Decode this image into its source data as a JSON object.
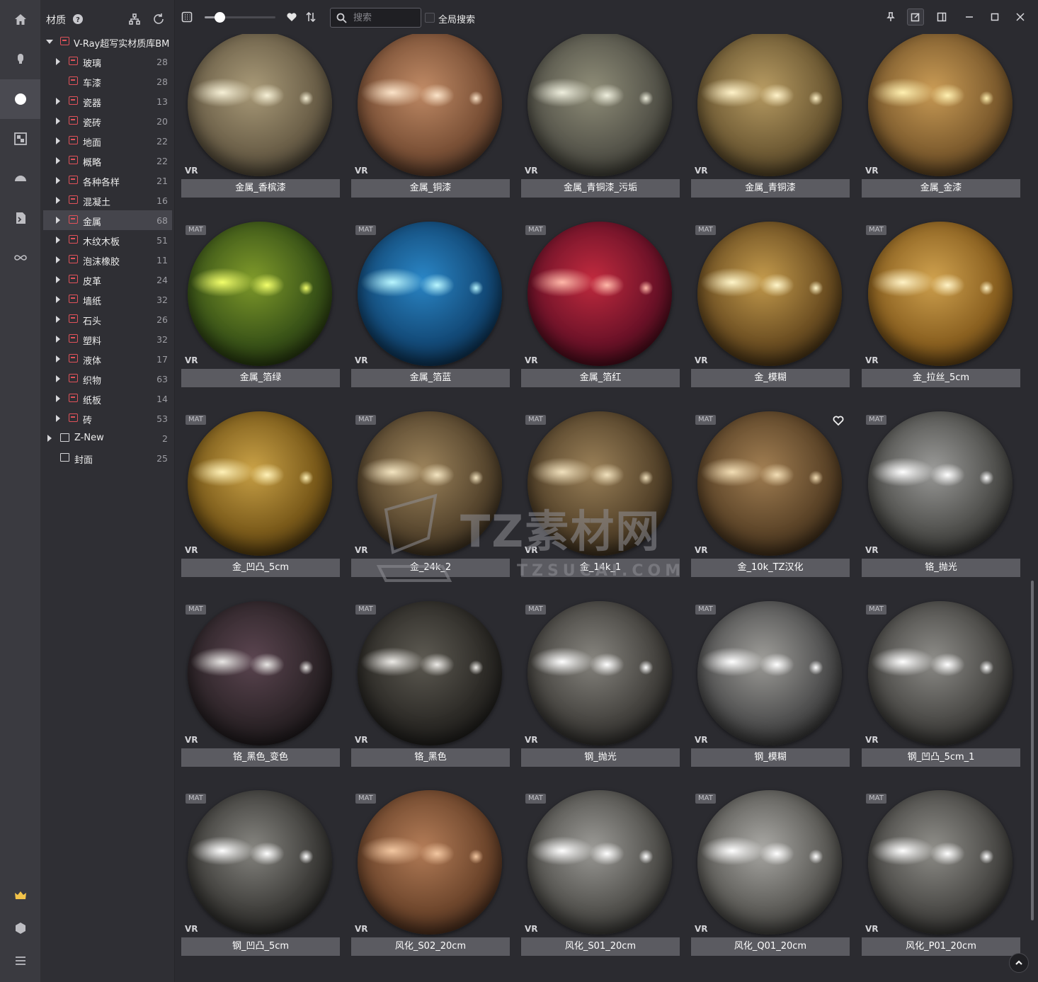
{
  "sidebar_rail": {
    "items": [
      {
        "name": "home-icon",
        "active": false
      },
      {
        "name": "model-icon",
        "active": false
      },
      {
        "name": "material-icon",
        "active": true
      },
      {
        "name": "texture-icon",
        "active": false
      },
      {
        "name": "lighting-icon",
        "active": false
      },
      {
        "name": "script-icon",
        "active": false
      },
      {
        "name": "infinity-icon",
        "active": false
      }
    ],
    "bottom": [
      {
        "name": "crown-icon",
        "color": "#f2c34a"
      },
      {
        "name": "cube-icon",
        "color": "#bdbdc2"
      },
      {
        "name": "menu-icon",
        "color": "#bdbdc2"
      }
    ]
  },
  "tree": {
    "title": "材质",
    "help_icon": "help-icon",
    "root": {
      "label": "V-Ray超写实材质库BM"
    },
    "items": [
      {
        "label": "玻璃",
        "count": "28",
        "has_children": true,
        "selected": false
      },
      {
        "label": "车漆",
        "count": "28",
        "has_children": false,
        "selected": false
      },
      {
        "label": "瓷器",
        "count": "13",
        "has_children": true,
        "selected": false
      },
      {
        "label": "瓷砖",
        "count": "20",
        "has_children": true,
        "selected": false
      },
      {
        "label": "地面",
        "count": "22",
        "has_children": true,
        "selected": false
      },
      {
        "label": "概略",
        "count": "22",
        "has_children": true,
        "selected": false
      },
      {
        "label": "各种各样",
        "count": "21",
        "has_children": true,
        "selected": false
      },
      {
        "label": "混凝土",
        "count": "16",
        "has_children": true,
        "selected": false
      },
      {
        "label": "金属",
        "count": "68",
        "has_children": true,
        "selected": true
      },
      {
        "label": "木纹木板",
        "count": "51",
        "has_children": true,
        "selected": false
      },
      {
        "label": "泡沫橡胶",
        "count": "11",
        "has_children": true,
        "selected": false
      },
      {
        "label": "皮革",
        "count": "24",
        "has_children": true,
        "selected": false
      },
      {
        "label": "墙纸",
        "count": "32",
        "has_children": true,
        "selected": false
      },
      {
        "label": "石头",
        "count": "26",
        "has_children": true,
        "selected": false
      },
      {
        "label": "塑料",
        "count": "32",
        "has_children": true,
        "selected": false
      },
      {
        "label": "液体",
        "count": "17",
        "has_children": true,
        "selected": false
      },
      {
        "label": "织物",
        "count": "63",
        "has_children": true,
        "selected": false
      },
      {
        "label": "纸板",
        "count": "14",
        "has_children": true,
        "selected": false
      },
      {
        "label": "砖",
        "count": "53",
        "has_children": true,
        "selected": false
      }
    ],
    "folders": [
      {
        "label": "Z-New",
        "count": "2",
        "has_children": true
      },
      {
        "label": "封面",
        "count": "25",
        "has_children": false
      }
    ]
  },
  "toolbar": {
    "search_placeholder": "搜索",
    "global_search_label": "全局搜索",
    "thumbnail_size": 0.22
  },
  "grid": {
    "badge_text": "MAT",
    "renderer_label": "VR",
    "cards": [
      {
        "name": "金属_香槟漆",
        "badge": false,
        "fav": false,
        "colors": [
          "#f6f0d6",
          "#a99a78",
          "#6b5f48",
          "#2c2923"
        ]
      },
      {
        "name": "金属_铜漆",
        "badge": false,
        "fav": false,
        "colors": [
          "#fbe3c8",
          "#c08a65",
          "#7a5036",
          "#2c2019"
        ]
      },
      {
        "name": "金属_青铜漆_污垢",
        "badge": false,
        "fav": false,
        "colors": [
          "#eeeedd",
          "#8f8d78",
          "#55544a",
          "#25251f"
        ]
      },
      {
        "name": "金属_青铜漆",
        "badge": false,
        "fav": false,
        "colors": [
          "#fff2c8",
          "#b79b62",
          "#6e5a34",
          "#2c2416"
        ]
      },
      {
        "name": "金属_金漆",
        "badge": false,
        "fav": false,
        "colors": [
          "#fff0b0",
          "#c99b55",
          "#7e5c2e",
          "#2f2212"
        ]
      },
      {
        "name": "金属_箔绿",
        "badge": true,
        "fav": false,
        "colors": [
          "#f2ff6a",
          "#7f9a2a",
          "#3a5418",
          "#141d08"
        ]
      },
      {
        "name": "金属_箔蓝",
        "badge": true,
        "fav": false,
        "colors": [
          "#b8f6ff",
          "#2a86c6",
          "#134a78",
          "#071a2c"
        ]
      },
      {
        "name": "金属_箔红",
        "badge": true,
        "fav": false,
        "colors": [
          "#ffb7a8",
          "#c12a3e",
          "#6d1228",
          "#24060d"
        ]
      },
      {
        "name": "金_模糊",
        "badge": true,
        "fav": false,
        "colors": [
          "#fff5c8",
          "#c39a4c",
          "#6d4f22",
          "#24190a"
        ]
      },
      {
        "name": "金_拉丝_5cm",
        "badge": true,
        "fav": false,
        "colors": [
          "#fff2c4",
          "#cfa14e",
          "#8a6020",
          "#2f1e08"
        ]
      },
      {
        "name": "金_凹凸_5cm",
        "badge": true,
        "fav": false,
        "colors": [
          "#fff1b6",
          "#c9a146",
          "#7a5a1a",
          "#2a1c06"
        ]
      },
      {
        "name": "金_24k_2",
        "badge": true,
        "fav": false,
        "colors": [
          "#f3e4c0",
          "#9c835b",
          "#57462e",
          "#1f1911"
        ]
      },
      {
        "name": "金_14k_1",
        "badge": true,
        "fav": false,
        "colors": [
          "#f0e0bc",
          "#9a8058",
          "#56442b",
          "#1e1810"
        ]
      },
      {
        "name": "金_10k_TZ汉化",
        "badge": true,
        "fav": true,
        "colors": [
          "#f2ddb4",
          "#a17e52",
          "#5c4428",
          "#20170c"
        ]
      },
      {
        "name": "铬_抛光",
        "badge": true,
        "fav": false,
        "colors": [
          "#ffffff",
          "#9a9a98",
          "#4f4f4c",
          "#1c1c1b"
        ]
      },
      {
        "name": "铬_黑色_变色",
        "badge": true,
        "fav": false,
        "colors": [
          "#e8e6e4",
          "#5b4550",
          "#2e2529",
          "#111011"
        ]
      },
      {
        "name": "铬_黑色",
        "badge": true,
        "fav": false,
        "colors": [
          "#eceae6",
          "#5d5a52",
          "#2d2b27",
          "#111110"
        ]
      },
      {
        "name": "钢_抛光",
        "badge": true,
        "fav": false,
        "colors": [
          "#ffffff",
          "#86847e",
          "#45433f",
          "#171716"
        ]
      },
      {
        "name": "钢_模糊",
        "badge": true,
        "fav": false,
        "colors": [
          "#ffffff",
          "#9d9c98",
          "#505050",
          "#1a1a1a"
        ]
      },
      {
        "name": "钢_凹凸_5cm_1",
        "badge": true,
        "fav": false,
        "colors": [
          "#ffffff",
          "#8d8c88",
          "#494845",
          "#181817"
        ]
      },
      {
        "name": "钢_凹凸_5cm",
        "badge": true,
        "fav": false,
        "colors": [
          "#ffffff",
          "#868580",
          "#3e3d3a",
          "#161615"
        ]
      },
      {
        "name": "风化_S02_20cm",
        "badge": true,
        "fav": false,
        "colors": [
          "#f2c6a0",
          "#b37c57",
          "#6e462c",
          "#261710"
        ]
      },
      {
        "name": "风化_S01_20cm",
        "badge": true,
        "fav": false,
        "colors": [
          "#ffffff",
          "#9b9a96",
          "#52514d",
          "#1b1b1a"
        ]
      },
      {
        "name": "风化_Q01_20cm",
        "badge": true,
        "fav": false,
        "colors": [
          "#ffffff",
          "#a9a8a4",
          "#5b5a56",
          "#1e1e1d"
        ]
      },
      {
        "name": "风化_P01_20cm",
        "badge": true,
        "fav": false,
        "colors": [
          "#ffffff",
          "#8f8e89",
          "#4a4946",
          "#191918"
        ]
      }
    ]
  },
  "watermark": {
    "logo_text": "TZ素材网",
    "url_text": "TZSUCAI.COM"
  }
}
